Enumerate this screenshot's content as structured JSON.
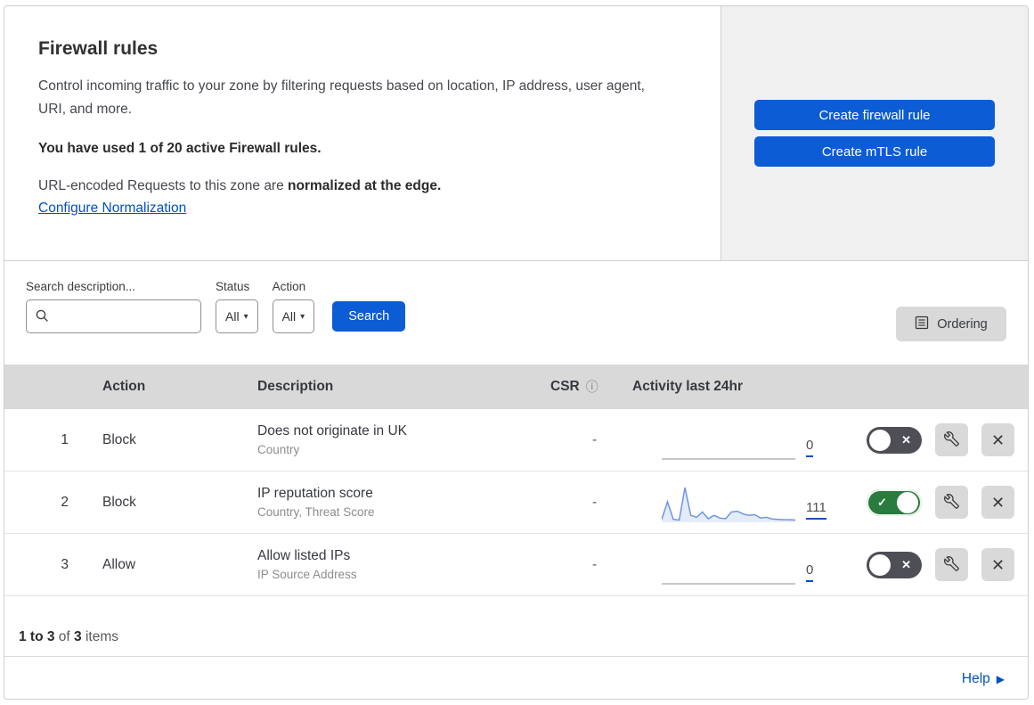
{
  "header": {
    "title": "Firewall rules",
    "description": "Control incoming traffic to your zone by filtering requests based on location, IP address, user agent, URI, and more.",
    "usage_bold": "You have used 1 of 20 active Firewall rules.",
    "normalization_prefix": "URL-encoded Requests to this zone are ",
    "normalization_bold": "normalized at the edge.",
    "normalization_link": "Configure Normalization",
    "create_firewall_button": "Create firewall rule",
    "create_mtls_button": "Create mTLS rule"
  },
  "filters": {
    "search_label": "Search description...",
    "search_value": "",
    "status_label": "Status",
    "status_value": "All",
    "action_label": "Action",
    "action_value": "All",
    "search_button": "Search",
    "ordering_button": "Ordering"
  },
  "table": {
    "columns": {
      "action": "Action",
      "description": "Description",
      "csr": "CSR",
      "activity": "Activity last 24hr"
    },
    "rows": [
      {
        "number": "1",
        "action": "Block",
        "description": "Does not originate in UK",
        "criteria": "Country",
        "csr": "-",
        "activity_count": "0",
        "enabled": false,
        "spark": []
      },
      {
        "number": "2",
        "action": "Block",
        "description": "IP reputation score",
        "criteria": "Country, Threat Score",
        "csr": "-",
        "activity_count": "111",
        "enabled": true,
        "spark": [
          6,
          58,
          6,
          4,
          100,
          18,
          12,
          28,
          8,
          18,
          10,
          8,
          28,
          30,
          22,
          18,
          20,
          10,
          12,
          7,
          6,
          5,
          5,
          4
        ]
      },
      {
        "number": "3",
        "action": "Allow",
        "description": "Allow listed IPs",
        "criteria": "IP Source Address",
        "csr": "-",
        "activity_count": "0",
        "enabled": false,
        "spark": []
      }
    ]
  },
  "footer": {
    "range_bold": "1 to 3",
    "of_text": " of ",
    "total_bold": "3",
    "items_text": " items",
    "help_link": "Help"
  },
  "icons": {
    "info": "ⓘ",
    "caret": "▾",
    "toggle_check": "✓",
    "toggle_x": "✕",
    "close": "✕",
    "help_arrow": "▶"
  },
  "colors": {
    "primary_blue": "#0b5cd5",
    "link_blue": "#0051c3",
    "toggle_on_green": "#2a7b3e",
    "toggle_off_gray": "#4e4e56",
    "sparkline_blue": "#6d96dd",
    "panel_gray": "#f0f0f0",
    "table_header_gray": "#d9d9d9"
  }
}
